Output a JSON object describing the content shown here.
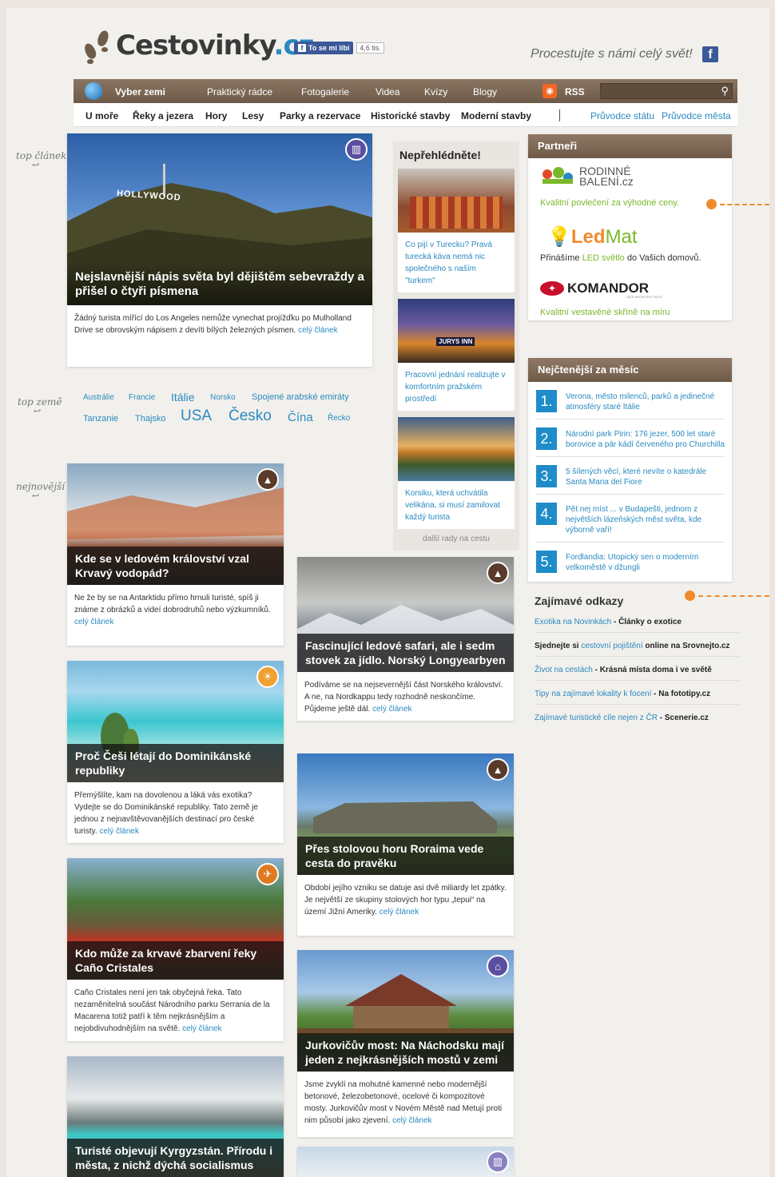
{
  "header": {
    "logo_text": "Cestovinky",
    "logo_tld": ".cz",
    "fb_like_label": "To se mi líbí",
    "fb_like_count": "4,6 tis.",
    "slogan": "Procestujte s námi celý svět!"
  },
  "nav": {
    "items": [
      "Vyber zemi",
      "Praktický rádce",
      "Fotogalerie",
      "Videa",
      "Kvízy",
      "Blogy",
      "RSS"
    ],
    "search_placeholder": ""
  },
  "subnav": {
    "items": [
      "U moře",
      "Řeky a jezera",
      "Hory",
      "Lesy",
      "Parky a rezervace",
      "Historické stavby",
      "Moderní stavby"
    ],
    "right": [
      "Průvodce státu",
      "Průvodce města"
    ]
  },
  "side_labels": {
    "top": "top článek",
    "zeme": "top země",
    "newest": "nejnovější"
  },
  "top_article": {
    "sign": "HOLLYWOOD",
    "title": "Nejslavnější nápis světa byl dějištěm sebevraždy a přišel o čtyři písmena",
    "text": "Žádný turista mířící do Los Angeles nemůže vynechat projížďku po Mulholland Drive se obrovským nápisem z devíti bílých železných písmen.",
    "more": "celý článek"
  },
  "tags": [
    {
      "label": "Austrálie"
    },
    {
      "label": "Francie"
    },
    {
      "label": "Itálie"
    },
    {
      "label": "Norsko"
    },
    {
      "label": "Spojené arabské emiráty"
    },
    {
      "label": "Tanzanie"
    },
    {
      "label": "Thajsko"
    },
    {
      "label": "USA"
    },
    {
      "label": "Česko"
    },
    {
      "label": "Čína"
    },
    {
      "label": "Řecko"
    }
  ],
  "nepreh": {
    "title": "Nepřehlédněte!",
    "items": [
      {
        "text": "Co pijí v Turecku? Pravá turecká káva nemá nic společného s naším \"turkem\""
      },
      {
        "text": "Pracovní jednání realizujte v komfortním pražském prostředí",
        "sign": "JURYS INN"
      },
      {
        "text": "Korsiku, která uchvátila velikána, si musí zamilovat každý turista"
      }
    ],
    "more": "další rady na cestu"
  },
  "partners": {
    "title": "Partneři",
    "items": [
      {
        "logo": "RODINNÉ BALENÍ.cz",
        "text": "Kvalitní povlečení za výhodné ceny."
      },
      {
        "logo_a": "Led",
        "logo_b": "Mat",
        "text_a": "Přinášíme ",
        "text_hl": "LED světlo",
        "text_b": " do Vašich domovů."
      },
      {
        "logo": "KOMANDOR",
        "logo_sub": "...VÍCE MÍSTA PRO ŽIVOT",
        "text": "Kvalitní vestavěné skříně na míru"
      }
    ]
  },
  "top_month": {
    "title": "Nejčtenější za měsíc",
    "items": [
      {
        "n": "1.",
        "text": "Verona, město milenců, parků a jedinečné atmosféry staré Itálie"
      },
      {
        "n": "2.",
        "text": "Národní park Pirin: 176 jezer, 500 let staré borovice a pár kádí červeného pro Churchilla"
      },
      {
        "n": "3.",
        "text": "5 šílených věcí, které nevíte o katedrále Santa Maria del Fiore"
      },
      {
        "n": "4.",
        "text": "Pět nej míst ... v Budapešti, jednom z největších lázeňských měst světa, kde výborně vaří!"
      },
      {
        "n": "5.",
        "text": "Fordlandia: Utopický sen o moderním velkoměstě v džungli"
      }
    ]
  },
  "links": {
    "title": "Zajímavé odkazy",
    "rows": [
      {
        "a": "Exotika na Novinkách",
        "sep": " - ",
        "b": "Články o exotice",
        "c": ""
      },
      {
        "a": "Sjednejte si ",
        "b": "cestovní pojištění",
        "c": " online na Srovnejto.cz"
      },
      {
        "a": "Život na cestách",
        "sep": " - ",
        "b": "Krásná místa doma i ve světě",
        "c": ""
      },
      {
        "a": "Tipy na zajímavé lokality k focení",
        "sep": " - ",
        "b": "Na fototipy.cz",
        "c": ""
      },
      {
        "a": "Zajímavé turistické cíle nejen z ČR",
        "sep": " - ",
        "b": "Scenerie.cz",
        "c": ""
      }
    ]
  },
  "articles_left": [
    {
      "title": "Kde se v ledovém království vzal Krvavý vodopád?",
      "text": "Ne že by se na Antarktidu přímo hrnuli turisté, spíš ji známe z obrázků a videí dobrodruhů nebo výzkumníků.",
      "more": "celý článek"
    },
    {
      "title": "Proč Češi létají do Dominikánské republiky",
      "text": "Přemýšlíte, kam na dovolenou a láká vás exotika? Vydejte se do Dominikánské republiky. Tato země je jednou z nejnavštěvovanějších destinací pro české turisty.",
      "more": "celý článek"
    },
    {
      "title": "Kdo může za krvavé zbarvení řeky Caño Cristales",
      "text": "Caño Cristales není jen tak obyčejná řeka. Tato nezaměnitelná součást Národního parku Serrania de la Macarena totiž patří k těm nejkrásnějším a nejobdivuhodnějším na světě.",
      "more": "celý článek"
    },
    {
      "title": "Turisté objevují Kyrgyzstán. Přírodu i města, z nichž dýchá socialismus",
      "text": "",
      "more": ""
    }
  ],
  "articles_mid": [
    {
      "title": "Fascinující ledové safari, ale i sedm stovek za jídlo. Norský Longyearbyen",
      "text": "Podíváme se na nejsevernější část Norského království. A ne, na Nordkappu tedy rozhodně neskončíme. Půjdeme ještě dál.",
      "more": "celý článek"
    },
    {
      "title": "Přes stolovou horu Roraima vede cesta do pravěku",
      "text": "Období jejího vzniku se datuje asi dvě miliardy let zpátky. Je největší ze skupiny stolových hor typu „tepui“ na území Jižní Ameriky.",
      "more": "celý článek"
    },
    {
      "title": "Jurkovičův most: Na Náchodsku mají jeden z nejkrásnějších mostů v zemi",
      "text": "Jsme zvyklí na mohutné kamenné nebo modernější betonové, železobetonové, ocelové či kompozitové mosty. Jurkovičův most v Novém Městě nad Metují proti nim působí jako zjevení.",
      "more": "celý článek"
    }
  ],
  "colors": {
    "accent": "#2a8ac0",
    "nav": "#7a6552",
    "number": "#1e8cc8",
    "highlight": "#f08a2c",
    "partner_green": "#7ab82b"
  },
  "icons": [
    "footprints-icon",
    "globe-icon",
    "rss-icon",
    "search-icon",
    "facebook-icon",
    "mountain-icon",
    "beach-icon",
    "hiking-icon",
    "building-icon"
  ]
}
